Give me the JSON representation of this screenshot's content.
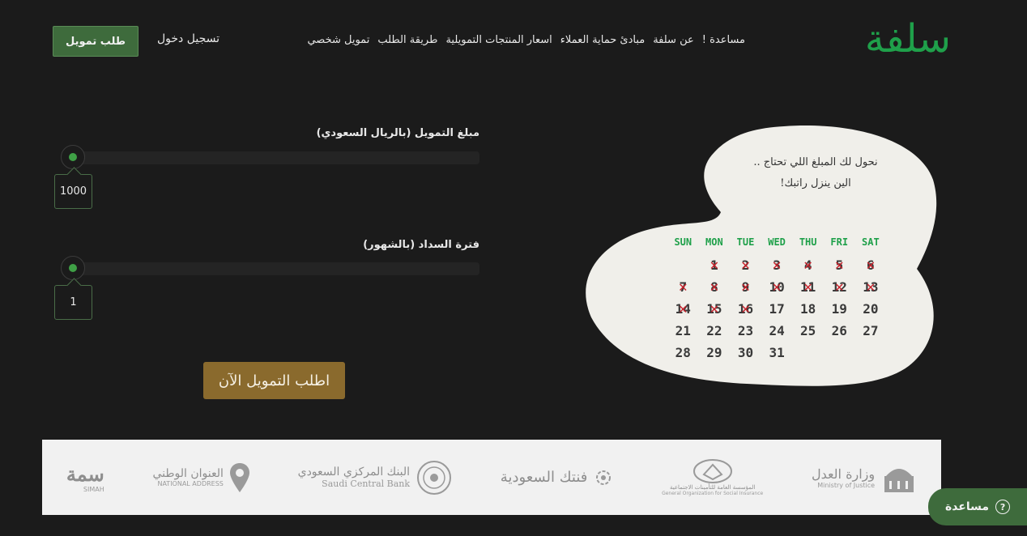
{
  "header": {
    "logo": "سلفة",
    "nav": [
      "تمويل شخصي",
      "طريقة الطلب",
      "اسعار المنتجات التمويلية",
      "مبادئ حماية العملاء",
      "عن سلفة",
      "مساعدة !"
    ],
    "login": "تسجيل دخول",
    "request_button": "طلب تمويل"
  },
  "form": {
    "amount_label": "مبلغ التمويل (بالريال السعودي)",
    "amount_value": "1000",
    "period_label": "فترة السداد (بالشهور)",
    "period_value": "1",
    "apply_button": "اطلب التمويل الآن"
  },
  "promo": {
    "line1": "نحول لك المبلغ اللي تحتاج ..",
    "line2": "الين ينزل راتبك!"
  },
  "calendar": {
    "days": [
      "SUN",
      "MON",
      "TUE",
      "WED",
      "THU",
      "FRI",
      "SAT"
    ],
    "rows": [
      [
        "",
        "1",
        "2",
        "3",
        "4",
        "5",
        "6"
      ],
      [
        "7",
        "8",
        "9",
        "10",
        "11",
        "12",
        "13"
      ],
      [
        "14",
        "15",
        "16",
        "17",
        "18",
        "19",
        "20"
      ],
      [
        "21",
        "22",
        "23",
        "24",
        "25",
        "26",
        "27"
      ],
      [
        "28",
        "29",
        "30",
        "31",
        "",
        "",
        ""
      ]
    ],
    "crossed_through": 16
  },
  "partners": [
    {
      "name": "ministry-of-justice",
      "ar": "وزارة العدل",
      "en": "Ministry of Justice"
    },
    {
      "name": "gosi",
      "ar": "المؤسسة العامة للتأمينات الاجتماعية",
      "en": "General Organization for Social Insurance"
    },
    {
      "name": "fintech-saudi",
      "ar": "فنتك السعودية",
      "en": ""
    },
    {
      "name": "saudi-central-bank",
      "ar": "البنك المركزي السعودي",
      "en": "Saudi Central Bank"
    },
    {
      "name": "national-address",
      "ar": "العنوان الوطني",
      "en": "NATIONAL ADDRESS"
    },
    {
      "name": "simah",
      "ar": "سمة",
      "en": "SIMAH"
    }
  ],
  "help_button": "مساعدة",
  "colors": {
    "background": "#1b1b1b",
    "brand_green": "#1fa04a",
    "button_green": "#3e6b3c",
    "apply_gold": "#8a6a2d",
    "cross_red": "#c8202a"
  },
  "sliders": {
    "amount_fill": 0,
    "period_fill": 0
  }
}
